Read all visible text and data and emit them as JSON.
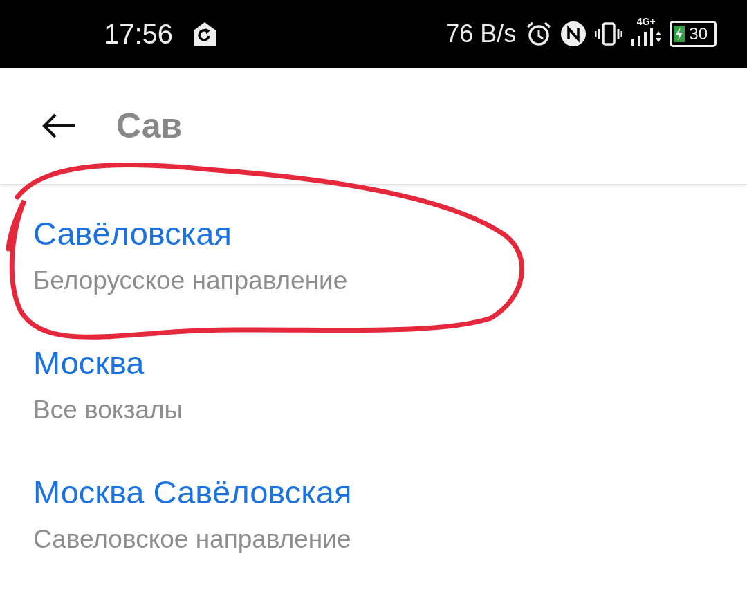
{
  "status_bar": {
    "time": "17:56",
    "net_speed": "76 B/s",
    "network_type": "4G+",
    "battery": "30",
    "charging": true
  },
  "search": {
    "value": "Сав"
  },
  "results": [
    {
      "title": "Савёловская",
      "subtitle": "Белорусское направление",
      "circled": true
    },
    {
      "title": "Москва",
      "subtitle": "Все вокзалы",
      "circled": false
    },
    {
      "title": "Москва Савёловская",
      "subtitle": "Савеловское направление",
      "circled": false
    }
  ]
}
